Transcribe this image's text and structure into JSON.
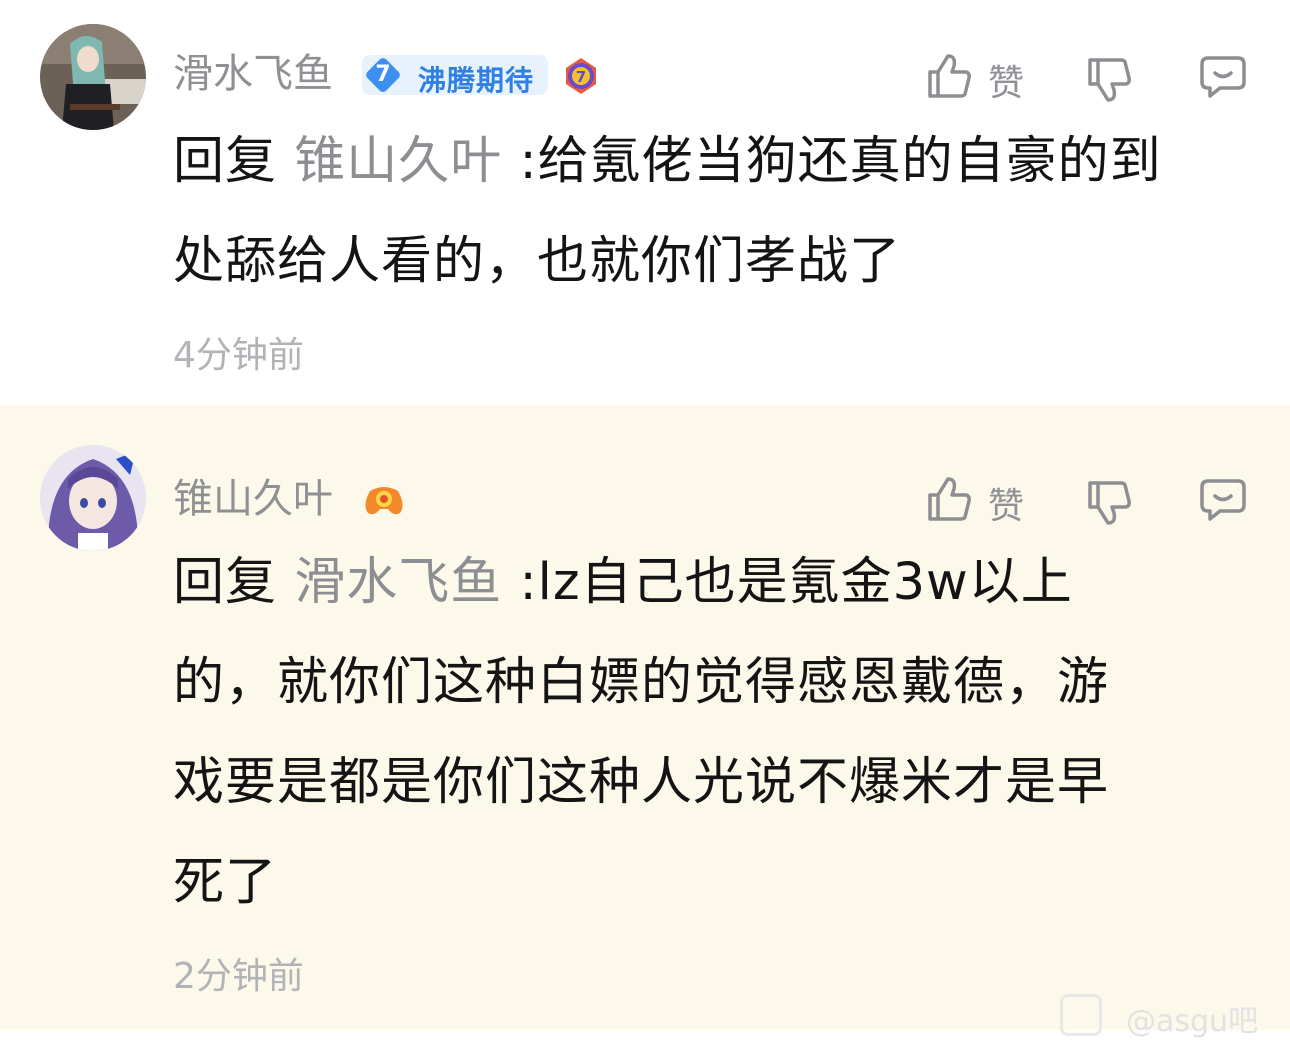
{
  "comments": [
    {
      "username": "滑水飞鱼",
      "badge": {
        "level": "7",
        "label": "沸腾期待"
      },
      "honor_icon": "level-7-medal-icon",
      "like_label": "赞",
      "reply_prefix": "回复",
      "reply_to": "锥山久叶",
      "text_line1": ":给氪佬当狗还真的自豪的到",
      "text_line2": "处舔给人看的，也就你们孝战了",
      "time": "4分钟前",
      "avatar": "anime-girl-green-hair-avatar"
    },
    {
      "username": "锥山久叶",
      "honor_icon": "gamepad-icon",
      "like_label": "赞",
      "reply_prefix": "回复",
      "reply_to": "滑水飞鱼",
      "text_line1": ":lz自己也是氪金3w以上",
      "text_line2": "的，就你们这种白嫖的觉得感恩戴德，游",
      "text_line3": "戏要是都是你们这种人光说不爆米才是早",
      "text_line4": "死了",
      "time": "2分钟前",
      "avatar": "anime-girl-purple-hair-avatar"
    }
  ],
  "watermark": {
    "text": "@asgu吧"
  },
  "colors": {
    "highlight_bg": "#fcf9eb",
    "text": "#141414",
    "muted": "#8f9093",
    "badge_blue": "#3d8ff0"
  }
}
